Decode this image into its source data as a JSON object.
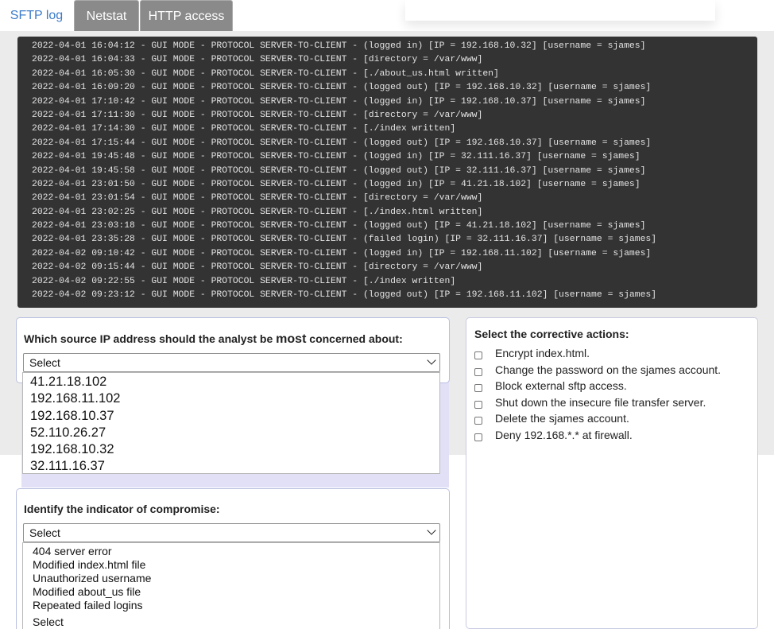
{
  "tabs": [
    {
      "label": "SFTP log"
    },
    {
      "label": "Netstat"
    },
    {
      "label": "HTTP access"
    }
  ],
  "log_lines": [
    "2022-04-01 16:04:12 - GUI MODE - PROTOCOL SERVER-TO-CLIENT - (logged in) [IP = 192.168.10.32] [username = sjames]",
    "2022-04-01 16:04:33 - GUI MODE - PROTOCOL SERVER-TO-CLIENT - [directory = /var/www]",
    "2022-04-01 16:05:30 - GUI MODE - PROTOCOL SERVER-TO-CLIENT - [./about_us.html written]",
    "2022-04-01 16:09:20 - GUI MODE - PROTOCOL SERVER-TO-CLIENT - (logged out) [IP = 192.168.10.32] [username = sjames]",
    "2022-04-01 17:10:42 - GUI MODE - PROTOCOL SERVER-TO-CLIENT - (logged in) [IP = 192.168.10.37] [username = sjames]",
    "2022-04-01 17:11:30 - GUI MODE - PROTOCOL SERVER-TO-CLIENT - [directory = /var/www]",
    "2022-04-01 17:14:30 - GUI MODE - PROTOCOL SERVER-TO-CLIENT - [./index written]",
    "2022-04-01 17:15:44 - GUI MODE - PROTOCOL SERVER-TO-CLIENT - (logged out) [IP = 192.168.10.37] [username = sjames]",
    "2022-04-01 19:45:48 - GUI MODE - PROTOCOL SERVER-TO-CLIENT - (logged in) [IP = 32.111.16.37] [username = sjames]",
    "2022-04-01 19:45:58 - GUI MODE - PROTOCOL SERVER-TO-CLIENT - (logged out) [IP = 32.111.16.37] [username = sjames]",
    "2022-04-01 23:01:50 - GUI MODE - PROTOCOL SERVER-TO-CLIENT - (logged in) [IP = 41.21.18.102] [username = sjames]",
    "2022-04-01 23:01:54 - GUI MODE - PROTOCOL SERVER-TO-CLIENT - [directory = /var/www]",
    "2022-04-01 23:02:25 - GUI MODE - PROTOCOL SERVER-TO-CLIENT - [./index.html written]",
    "2022-04-01 23:03:18 - GUI MODE - PROTOCOL SERVER-TO-CLIENT - (logged out) [IP = 41.21.18.102] [username = sjames]",
    "2022-04-01 23:35:28 - GUI MODE - PROTOCOL SERVER-TO-CLIENT - (failed login) [IP = 32.111.16.37] [username = sjames]",
    "2022-04-02 09:10:42 - GUI MODE - PROTOCOL SERVER-TO-CLIENT - (logged in) [IP = 192.168.11.102] [username = sjames]",
    "2022-04-02 09:15:44 - GUI MODE - PROTOCOL SERVER-TO-CLIENT - [directory = /var/www]",
    "2022-04-02 09:22:55 - GUI MODE - PROTOCOL SERVER-TO-CLIENT - [./index written]",
    "2022-04-02 09:23:12 - GUI MODE - PROTOCOL SERVER-TO-CLIENT - (logged out) [IP = 192.168.11.102] [username = sjames]"
  ],
  "q1": {
    "title_pre": "Which source IP address should the analyst be ",
    "title_emph": "most",
    "title_post": " concerned about:",
    "select_value": "Select",
    "options": [
      "41.21.18.102",
      "192.168.11.102",
      "192.168.10.37",
      "52.110.26.27",
      "192.168.10.32",
      "32.111.16.37"
    ]
  },
  "q2": {
    "title": "Identify the indicator of compromise:",
    "select_value": "Select",
    "options": [
      "404 server error",
      "Modified index.html file",
      "Unauthorized username",
      "Modified about_us file",
      "Repeated failed logins",
      "Select"
    ]
  },
  "actions": {
    "title": "Select the corrective actions:",
    "items": [
      {
        "label": "Encrypt index.html."
      },
      {
        "label": "Change the password on the sjames account."
      },
      {
        "label": "Block external sftp access."
      },
      {
        "label": "Shut down the insecure file transfer server."
      },
      {
        "label": "Delete the sjames account."
      },
      {
        "label": "Deny 192.168.*.* at firewall."
      }
    ]
  }
}
